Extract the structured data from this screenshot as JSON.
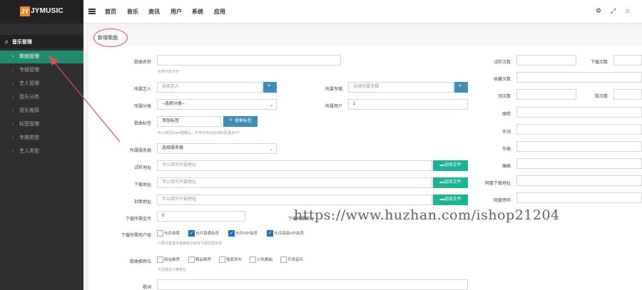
{
  "brand": {
    "mark": "JY",
    "name": "JYMUSIC"
  },
  "nav": [
    "首页",
    "音乐",
    "资讯",
    "用户",
    "系统",
    "应用"
  ],
  "sidebar": {
    "section": "音乐管理",
    "items": [
      "歌曲管理",
      "专辑管理",
      "艺人管理",
      "音乐分类",
      "音乐推荐",
      "标签管理",
      "专辑类型",
      "艺人类型"
    ]
  },
  "panel": {
    "title": "新增歌曲"
  },
  "form": {
    "song_name_label": "歌曲名称",
    "song_name_hint": "名称不能为空",
    "artist_label": "所属艺人",
    "artist_placeholder": "选择艺人",
    "album_label": "所属专辑",
    "album_placeholder": "选择所属专辑",
    "category_label": "所属分类",
    "category_value": "--选择分类--",
    "user_label": "所属用户",
    "user_value": "1",
    "tags_label": "歌曲标签",
    "tags_placeholder": "添加标签",
    "tags_button": "搜索标签",
    "tags_hint": "可以填写Enter键确认，不存在将会自动新增,最多4个",
    "server_label": "所属服务器",
    "server_value": "选择服务器",
    "listen_url_label": "试听地址",
    "listen_url_placeholder": "可以填写外链地址",
    "download_url_label": "下载地址",
    "download_url_placeholder": "可以填写外链地址",
    "cover_label": "封面地址",
    "cover_placeholder": "可以填写外链地址",
    "choose_file": "选择文件",
    "coins_label": "下载所需金币",
    "coins_value": "0",
    "coins_right_label": "下载所需积分",
    "groups_label": "下载所需用户组",
    "groups": [
      {
        "label": "允许游客",
        "checked": false
      },
      {
        "label": "允许普通会员",
        "checked": true
      },
      {
        "label": "允许VIP会员",
        "checked": true
      },
      {
        "label": "允许高级VIP会员",
        "checked": true
      }
    ],
    "groups_hint": "只要设置金币或者积分就有下载勾选无效",
    "recommend_label": "歌曲推荐位",
    "recommend": [
      "网站推荐",
      "精品推荐",
      "独家发布",
      "火热舞曲",
      "开场音乐"
    ],
    "recommend_hint": "可选择多个推荐位",
    "lyrics_label": "歌词"
  },
  "right": {
    "listen_count": "试听次数",
    "download_count": "下载次数",
    "favorite_count": "收藏次数",
    "like_count": "顶次数",
    "dislike_count": "踩次数",
    "composer": "原唱",
    "lyricist": "作词",
    "composer2": "作曲",
    "arranger": "编曲",
    "netdisk_url": "网盘下载地址",
    "netdisk_pwd": "网盘密码"
  },
  "watermark": "https://www.huzhan.com/ishop21204"
}
